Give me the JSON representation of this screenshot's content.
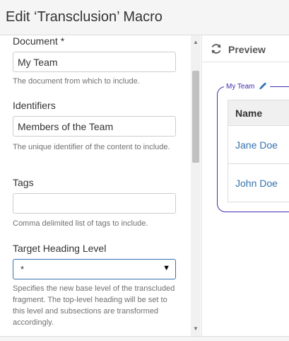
{
  "dialog": {
    "title": "Edit ‘Transclusion’ Macro"
  },
  "form": {
    "document": {
      "label": "Document *",
      "value": "My Team",
      "description": "The document from which to include."
    },
    "identifiers": {
      "label": "Identifiers",
      "value": "Members of the Team",
      "description": "The unique identifier of the content to include."
    },
    "tags": {
      "label": "Tags",
      "value": "",
      "description": "Comma delimited list of tags to include."
    },
    "target_heading_level": {
      "label": "Target Heading Level",
      "value": "*",
      "description": "Specifies the new base level of the transcluded fragment. The top-level heading will be set to this level and subsections are transformed accordingly."
    }
  },
  "preview": {
    "label": "Preview",
    "macro_name": "My Team",
    "table": {
      "header": "Name",
      "rows": [
        "Jane Doe",
        "John Doe"
      ]
    }
  },
  "colors": {
    "accent": "#3572b0",
    "macro_border": "#3f2fb0"
  },
  "icons": {
    "refresh": "refresh-icon",
    "edit": "pencil-icon",
    "dropdown": "chevron-down-icon"
  }
}
